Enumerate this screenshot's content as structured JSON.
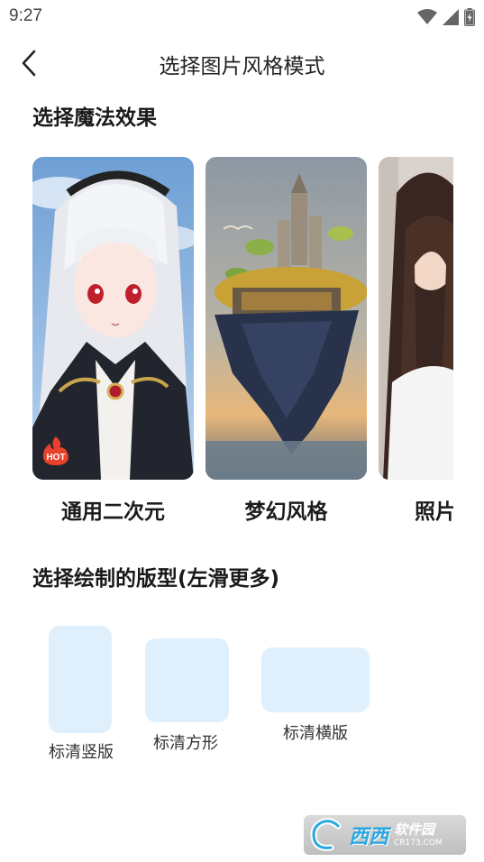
{
  "status": {
    "time": "9:27",
    "icons": [
      "wifi-icon",
      "signal-icon",
      "battery-icon"
    ]
  },
  "header": {
    "title": "选择图片风格模式",
    "back_icon": "chevron-left-icon"
  },
  "effects": {
    "title": "选择魔法效果",
    "items": [
      {
        "label": "通用二次元",
        "badge": "HOT"
      },
      {
        "label": "梦幻风格"
      },
      {
        "label": "照片"
      }
    ]
  },
  "layouts": {
    "title": "选择绘制的版型(左滑更多)",
    "items": [
      {
        "label": "标清竖版"
      },
      {
        "label": "标清方形"
      },
      {
        "label": "标清横版"
      }
    ]
  },
  "watermark": {
    "brand": "西西",
    "sub1": "软件园",
    "sub2": "CR173.COM"
  },
  "colors": {
    "layout_fill": "#dff0fc",
    "hot_badge": "#e8412c"
  }
}
